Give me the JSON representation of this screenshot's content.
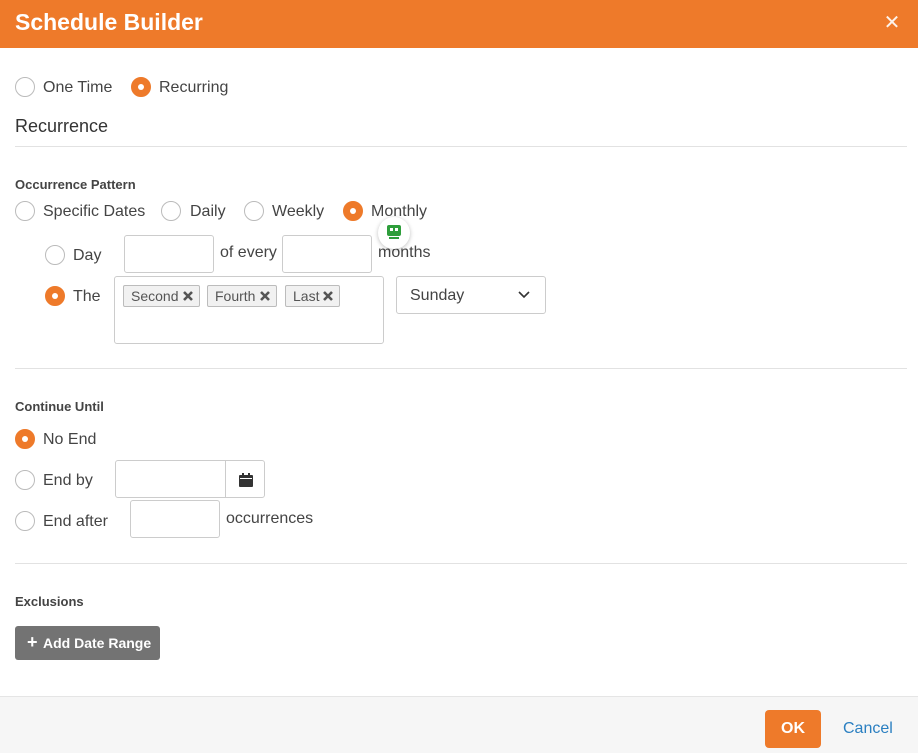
{
  "dialog": {
    "title": "Schedule Builder",
    "close_icon": "close-icon",
    "accent_color": "#ee7a2a"
  },
  "schedule_type": {
    "options": [
      {
        "label": "One Time",
        "checked": false
      },
      {
        "label": "Recurring",
        "checked": true
      }
    ]
  },
  "recurrence": {
    "heading": "Recurrence",
    "pattern_heading": "Occurrence Pattern",
    "patterns": [
      {
        "label": "Specific Dates",
        "checked": false
      },
      {
        "label": "Daily",
        "checked": false
      },
      {
        "label": "Weekly",
        "checked": false
      },
      {
        "label": "Monthly",
        "checked": true
      }
    ],
    "monthly": {
      "day_option": {
        "label": "Day",
        "checked": false,
        "day_value": "",
        "of_every_label": "of every",
        "months_value": "",
        "months_label": "months"
      },
      "the_option": {
        "label": "The",
        "checked": true,
        "tags": [
          "Second",
          "Fourth",
          "Last"
        ],
        "weekday": "Sunday"
      }
    }
  },
  "continue_until": {
    "heading": "Continue Until",
    "options": [
      {
        "label": "No End",
        "checked": true
      },
      {
        "label": "End by",
        "checked": false,
        "value": ""
      },
      {
        "label": "End after",
        "checked": false,
        "value": "",
        "suffix": "occurrences"
      }
    ]
  },
  "exclusions": {
    "heading": "Exclusions",
    "add_button": "Add Date Range"
  },
  "footer": {
    "ok": "OK",
    "cancel": "Cancel"
  }
}
